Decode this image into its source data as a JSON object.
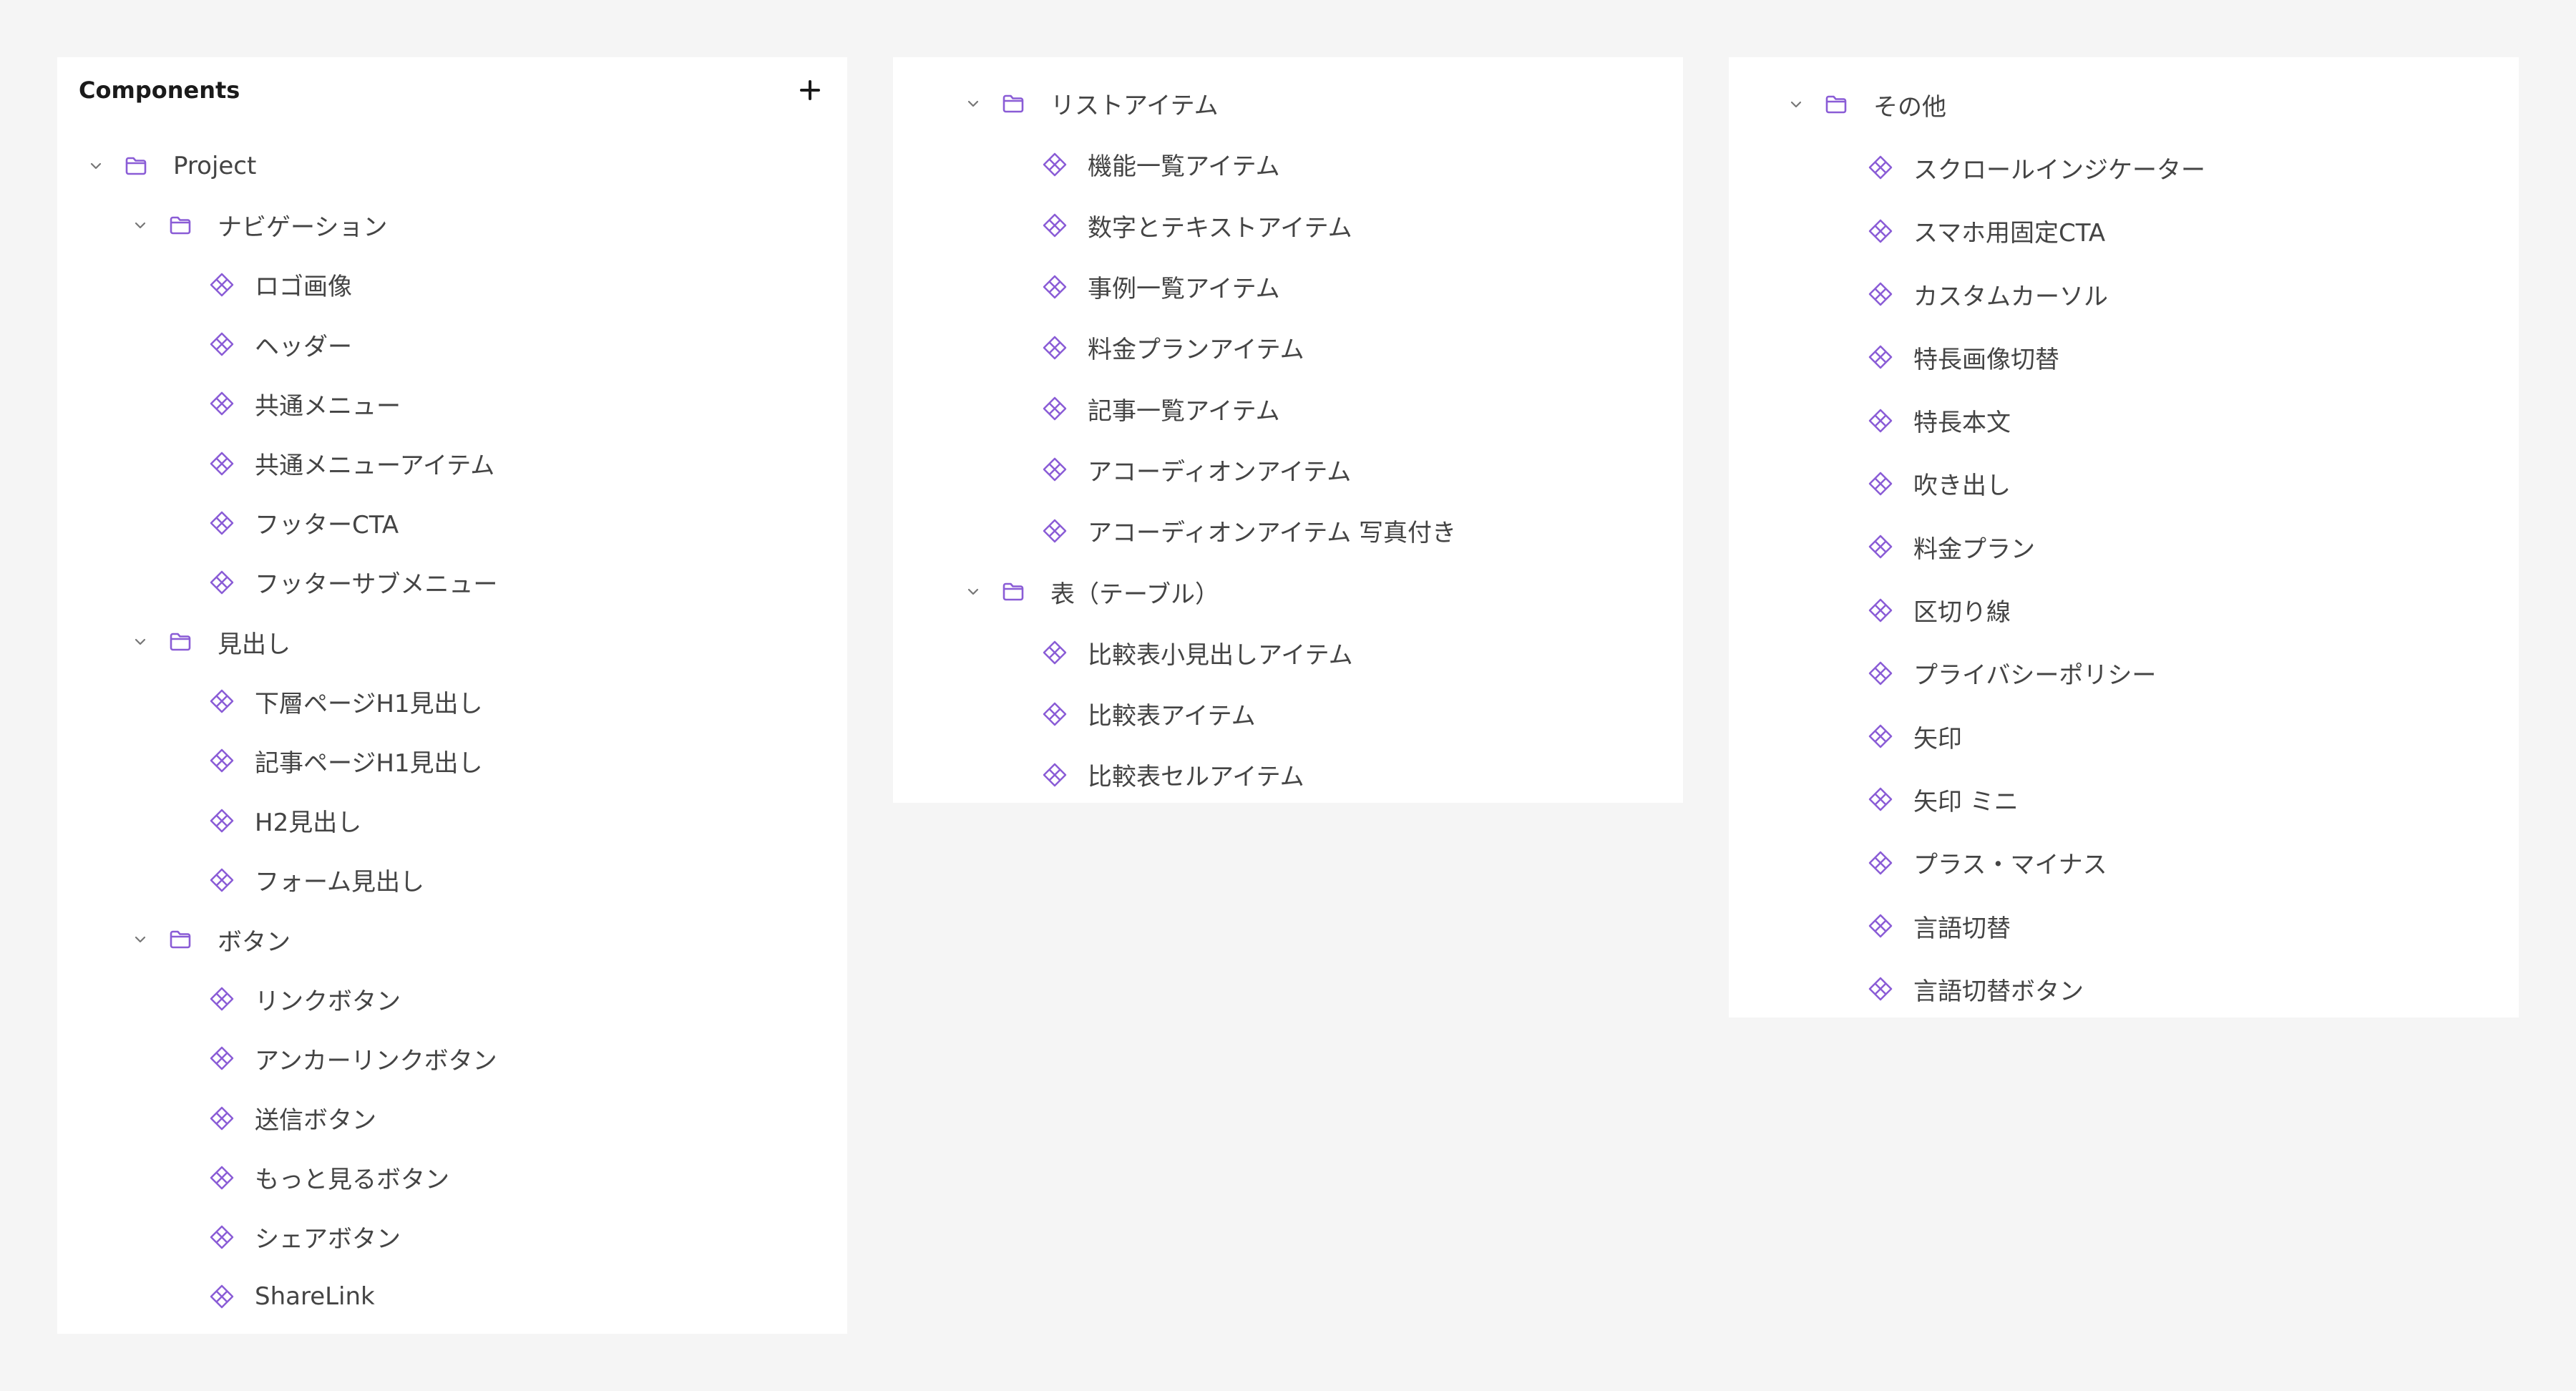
{
  "colors": {
    "accent": "#8a5cd6",
    "background": "#f5f5f5",
    "panel": "#ffffff",
    "text": "#444444"
  },
  "left": {
    "title": "Components",
    "add_icon": "plus-icon",
    "project": "Project",
    "navigation": {
      "label": "ナビゲーション",
      "items": [
        "ロゴ画像",
        "ヘッダー",
        "共通メニュー",
        "共通メニューアイテム",
        "フッターCTA",
        "フッターサブメニュー"
      ]
    },
    "headings": {
      "label": "見出し",
      "items": [
        "下層ページH1見出し",
        "記事ページH1見出し",
        "H2見出し",
        "フォーム見出し"
      ]
    },
    "buttons": {
      "label": "ボタン",
      "items": [
        "リンクボタン",
        "アンカーリンクボタン",
        "送信ボタン",
        "もっと見るボタン",
        "シェアボタン",
        "ShareLink"
      ]
    }
  },
  "middle": {
    "list_items": {
      "label": "リストアイテム",
      "items": [
        "機能一覧アイテム",
        "数字とテキストアイテム",
        "事例一覧アイテム",
        "料金プランアイテム",
        "記事一覧アイテム",
        "アコーディオンアイテム",
        "アコーディオンアイテム 写真付き"
      ]
    },
    "tables": {
      "label": "表（テーブル）",
      "items": [
        "比較表小見出しアイテム",
        "比較表アイテム",
        "比較表セルアイテム"
      ]
    }
  },
  "right": {
    "other": {
      "label": "その他",
      "items": [
        "スクロールインジケーター",
        "スマホ用固定CTA",
        "カスタムカーソル",
        "特長画像切替",
        "特長本文",
        "吹き出し",
        "料金プラン",
        "区切り線",
        "プライバシーポリシー",
        "矢印",
        "矢印 ミニ",
        "プラス・マイナス",
        "言語切替",
        "言語切替ボタン"
      ]
    }
  }
}
